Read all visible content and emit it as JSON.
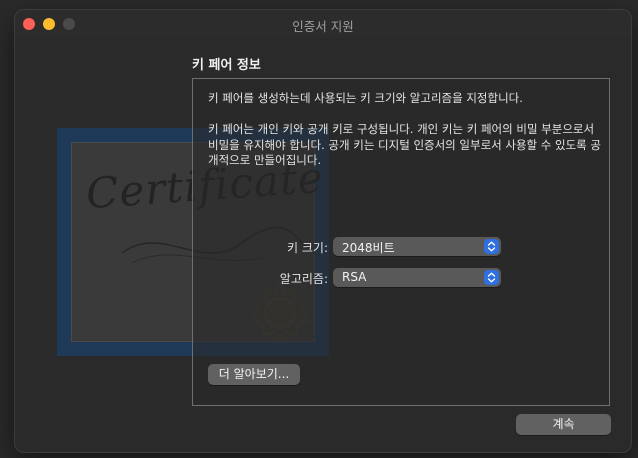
{
  "window": {
    "title": "인증서 지원"
  },
  "background": {
    "certificate_word": "Certificate"
  },
  "main": {
    "section_title": "키 페어 정보",
    "description_1": "키 페어를 생성하는데 사용되는 키 크기와 알고리즘을 지정합니다.",
    "description_2": "키 페어는 개인 키와 공개 키로 구성됩니다. 개인 키는 키 페어의 비밀 부분으로서 비밀을 유지해야 합니다. 공개 키는 디지털 인증서의 일부로서 사용할 수 있도록 공개적으로 만들어집니다.",
    "key_size": {
      "label": "키 크기:",
      "value": "2048비트"
    },
    "algorithm": {
      "label": "알고리즘:",
      "value": "RSA"
    },
    "learn_more_label": "더 알아보기..."
  },
  "footer": {
    "continue_label": "계속"
  },
  "colors": {
    "close": "#ff5f57",
    "minimize": "#febc2e",
    "zoom_disabled": "#4a4a4a",
    "accent": "#2f6fe0"
  },
  "icons": [
    "chevron-up-down-icon"
  ]
}
